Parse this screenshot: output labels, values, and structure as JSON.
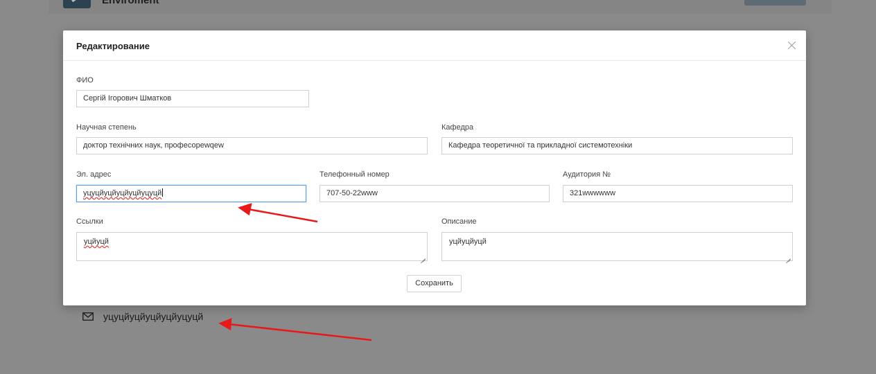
{
  "background": {
    "app_title": "Enviroment",
    "email_text": "уцуцйуцйуцйуцйуцуцй"
  },
  "modal": {
    "title": "Редактирование",
    "fields": {
      "fio": {
        "label": "ФИО",
        "value": "Сергій Ігорович Шматков"
      },
      "degree": {
        "label": "Научная степень",
        "value": "доктор технічних наук, професорewqew"
      },
      "department": {
        "label": "Кафедра",
        "value": "Кафедра теоретичної та прикладної системотехніки"
      },
      "email": {
        "label": "Эл. адрес",
        "value": "уцуцйуцйуцйуцйуцуцй"
      },
      "phone": {
        "label": "Телефонный номер",
        "value": "707-50-22www"
      },
      "room": {
        "label": "Аудитория №",
        "value": "321wwwwww"
      },
      "links": {
        "label": "Ссылки",
        "value": "уцйуцй"
      },
      "description": {
        "label": "Описание",
        "value": "уцйуцйуцй"
      }
    },
    "save_label": "Сохранить"
  },
  "colors": {
    "overlay": "#8a8a8a",
    "focus_border": "#5aa0e6",
    "annotation_arrow": "#e8191a"
  },
  "icons": {
    "close": "close-icon",
    "email": "envelope-icon"
  }
}
